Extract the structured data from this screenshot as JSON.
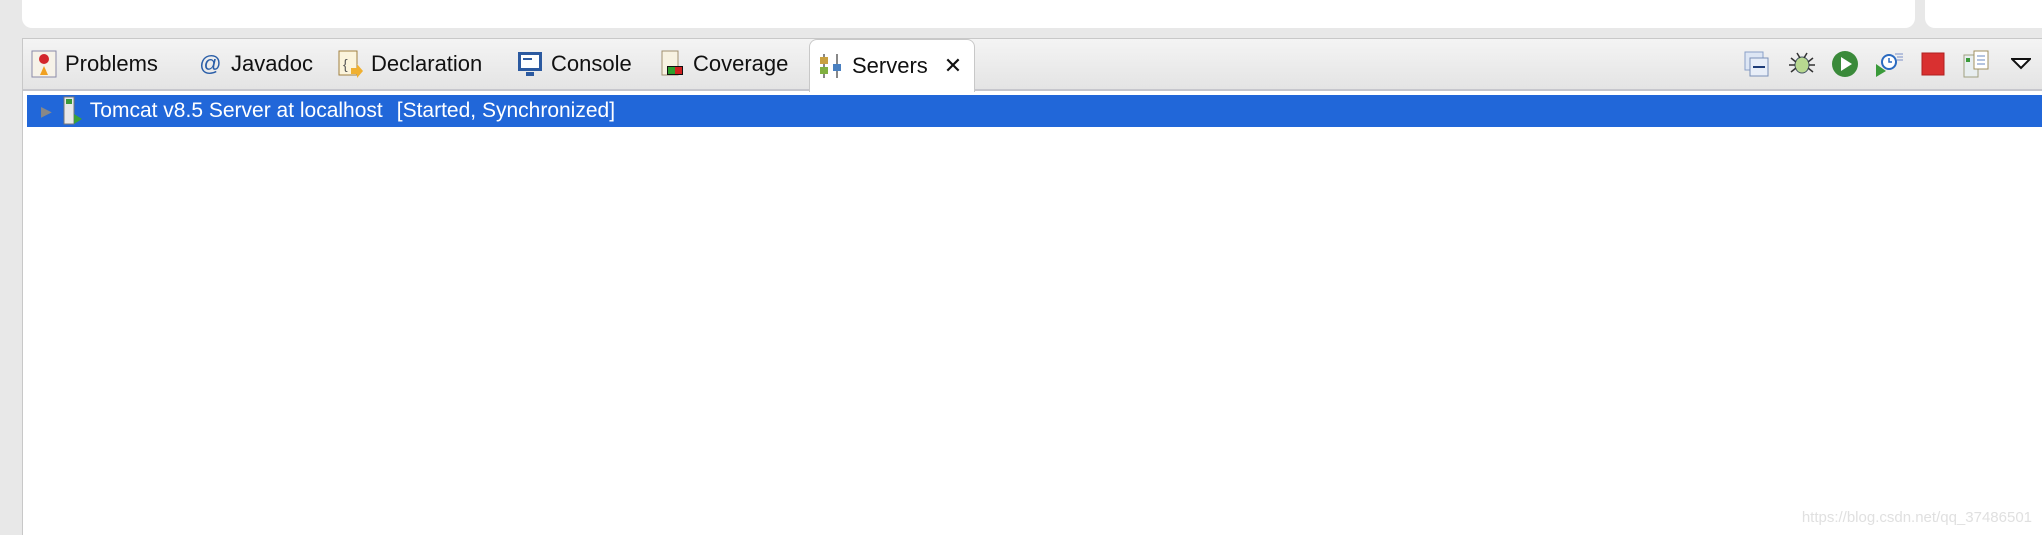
{
  "tabs": [
    {
      "label": "Problems",
      "icon": "problems-icon"
    },
    {
      "label": "Javadoc",
      "icon": "at-icon"
    },
    {
      "label": "Declaration",
      "icon": "declaration-icon"
    },
    {
      "label": "Console",
      "icon": "console-icon"
    },
    {
      "label": "Coverage",
      "icon": "coverage-icon"
    },
    {
      "label": "Servers",
      "icon": "servers-icon",
      "active": true
    }
  ],
  "toolbar": [
    "collapse-icon",
    "debug-icon",
    "start-icon",
    "profile-icon",
    "stop-icon",
    "publish-icon",
    "view-menu-icon"
  ],
  "servers": [
    {
      "name": "Tomcat v8.5 Server at localhost",
      "status": "[Started, Synchronized]"
    }
  ],
  "colors": {
    "selection": "#2167d9"
  },
  "watermark": "https://blog.csdn.net/qq_37486501"
}
